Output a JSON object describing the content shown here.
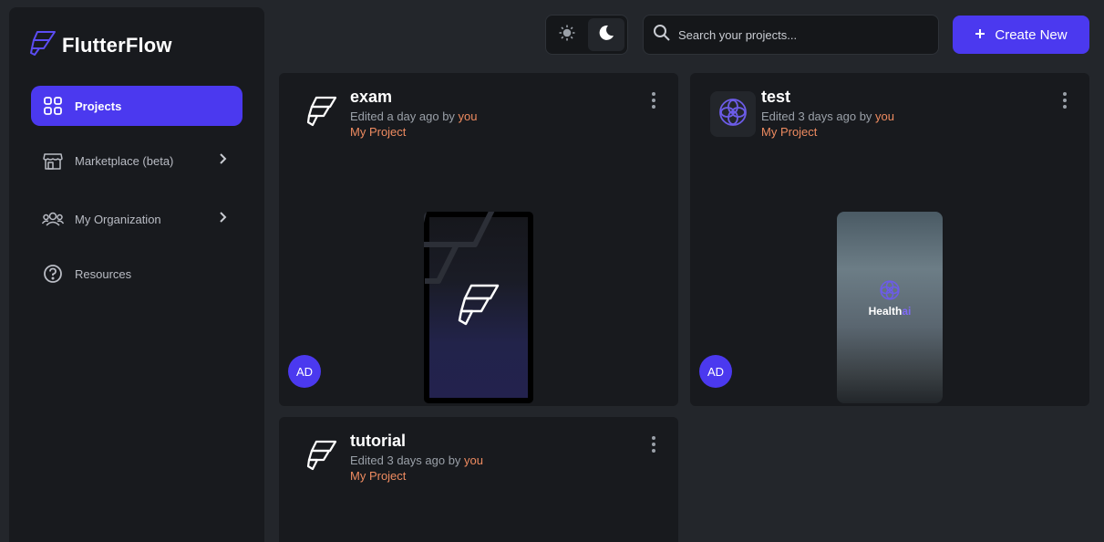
{
  "app": {
    "name": "FlutterFlow"
  },
  "sidebar": {
    "items": [
      {
        "label": "Projects",
        "icon": "grid-icon",
        "active": true
      },
      {
        "label": "Marketplace (beta)",
        "icon": "store-icon",
        "has_chevron": true
      },
      {
        "label": "My Organization",
        "icon": "people-icon",
        "has_chevron": true
      },
      {
        "label": "Resources",
        "icon": "question-icon"
      }
    ]
  },
  "toolbar": {
    "theme": {
      "light_icon": "sun-icon",
      "dark_icon": "moon-icon",
      "selected": "dark"
    },
    "search": {
      "placeholder": "Search your projects...",
      "value": ""
    },
    "create_label": "Create New"
  },
  "projects": [
    {
      "title": "exam",
      "edited_prefix": "Edited a day ago by ",
      "edited_by": "you",
      "project_label": "My Project",
      "avatar": "AD"
    },
    {
      "title": "test",
      "edited_prefix": "Edited 3 days ago by ",
      "edited_by": "you",
      "project_label": "My Project",
      "avatar": "AD",
      "preview_title": "Health",
      "preview_suffix": "ai"
    },
    {
      "title": "tutorial",
      "edited_prefix": "Edited 3 days ago by ",
      "edited_by": "you",
      "project_label": "My Project"
    }
  ],
  "colors": {
    "accent": "#4b39ef",
    "highlight": "#ee8b60",
    "background": "#23262b",
    "surface": "#181a1e"
  }
}
